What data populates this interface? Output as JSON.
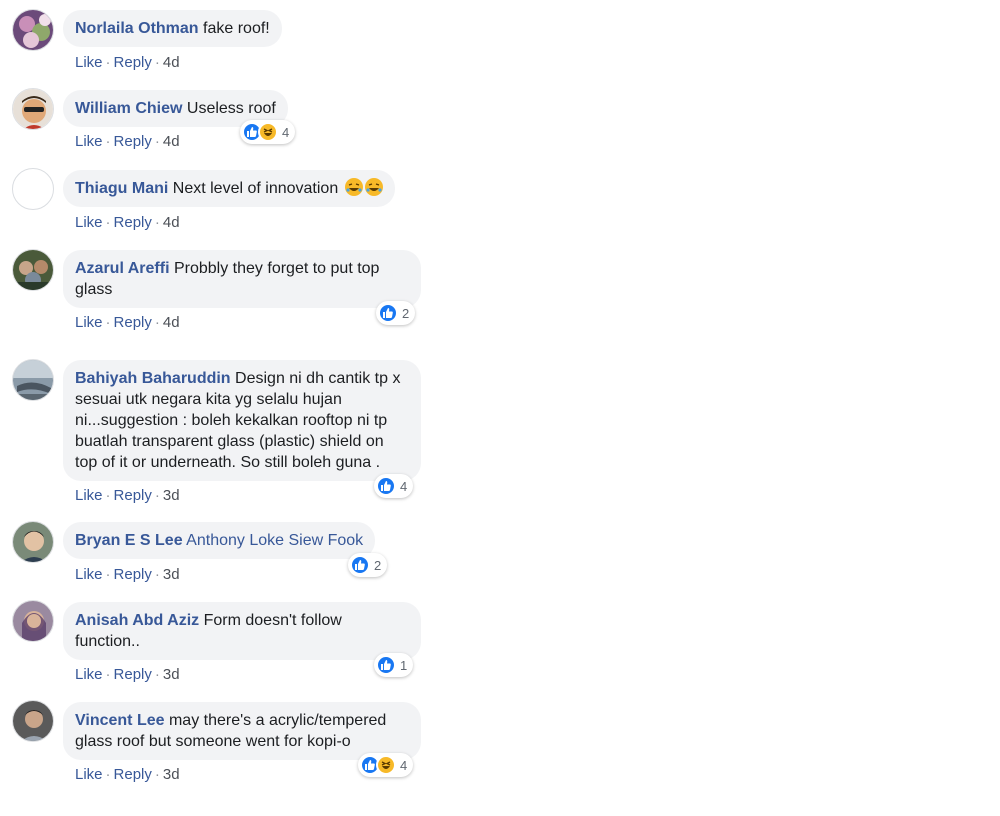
{
  "actions": {
    "like": "Like",
    "reply": "Reply",
    "sep": "·"
  },
  "comments": [
    {
      "author": "Norlaila Othman",
      "text": "fake roof!",
      "time": "4d",
      "reactions": null
    },
    {
      "author": "William Chiew",
      "text": "Useless roof",
      "time": "4d",
      "reactions": {
        "types": [
          "like",
          "haha"
        ],
        "count": "4"
      }
    },
    {
      "author": "Thiagu Mani",
      "text": "Next level of innovation",
      "emoji": "rolling-on-floor-laughing x2",
      "time": "4d",
      "reactions": null
    },
    {
      "author": "Azarul Areffi",
      "text": "Probbly they forget to put top glass",
      "time": "4d",
      "reactions": {
        "types": [
          "like"
        ],
        "count": "2"
      }
    },
    {
      "author": "Bahiyah Baharuddin",
      "text": "Design ni dh cantik tp x sesuai utk negara kita yg selalu hujan ni...suggestion : boleh kekalkan rooftop ni tp buatlah transparent glass (plastic) shield on top of it or underneath. So still boleh guna .",
      "time": "3d",
      "reactions": {
        "types": [
          "like"
        ],
        "count": "4"
      }
    },
    {
      "author": "Bryan E S Lee",
      "tag": "Anthony Loke Siew Fook",
      "text": "",
      "time": "3d",
      "reactions": {
        "types": [
          "like"
        ],
        "count": "2"
      }
    },
    {
      "author": "Anisah Abd Aziz",
      "text": "Form doesn't follow function..",
      "time": "3d",
      "reactions": {
        "types": [
          "like"
        ],
        "count": "1"
      }
    },
    {
      "author": "Vincent Lee",
      "text": "may there's a acrylic/tempered glass roof but someone went for kopi-o",
      "time": "3d",
      "reactions": {
        "types": [
          "like",
          "haha"
        ],
        "count": "4"
      }
    }
  ],
  "colors": {
    "link": "#385898",
    "bubble": "#f2f3f5",
    "like": "#1877f2",
    "haha": "#f7b928"
  }
}
